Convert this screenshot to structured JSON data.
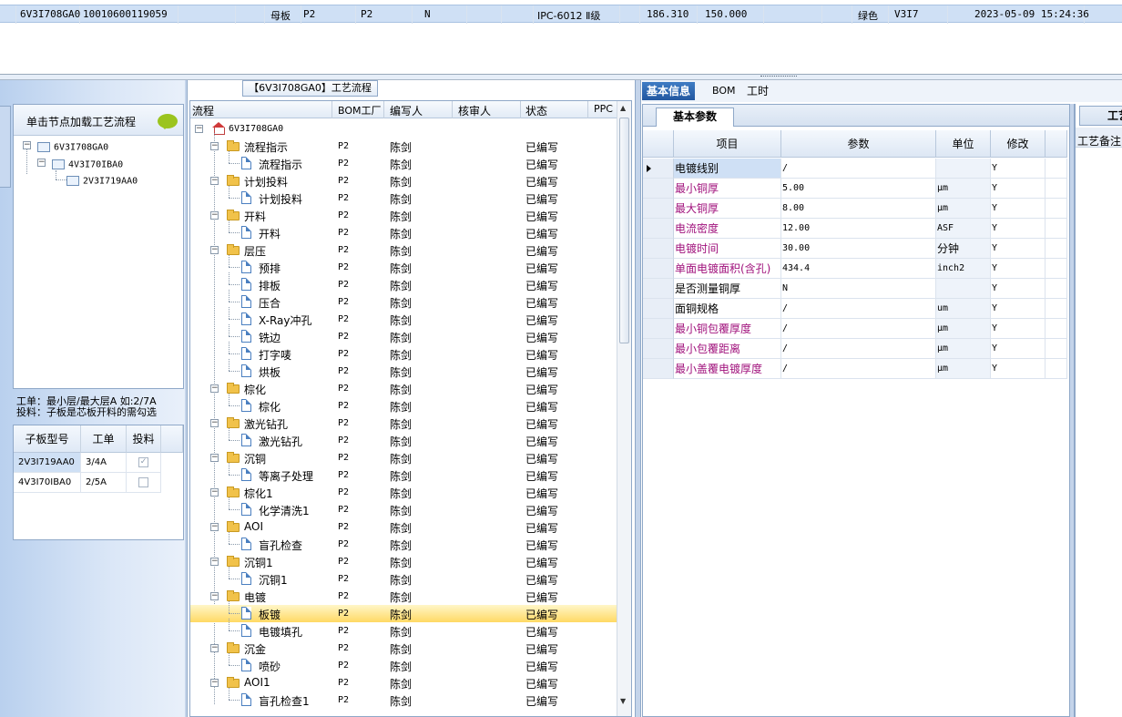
{
  "top_row": [
    "6V3I708GA0",
    "10010600119059",
    "母板",
    "P2",
    "P2",
    "N",
    "IPC-6012 Ⅱ级",
    "186.310",
    "150.000",
    "绿色",
    "V3I7",
    "2023-05-09 15:24:36"
  ],
  "left": {
    "header": "单击节点加载工艺流程",
    "tree": [
      "6V3I708GA0",
      "4V3I70IBA0",
      "2V3I719AA0"
    ],
    "note_line1": "工单：最小层/最大层A 如:2/7A",
    "note_line2": "投料：子板是芯板开料的需勾选",
    "grid_headers": [
      "子板型号",
      "工单",
      "投料"
    ],
    "grid_rows": [
      {
        "model": "2V3I719AA0",
        "order": "3/4A",
        "checked": true
      },
      {
        "model": "4V3I70IBA0",
        "order": "2/5A",
        "checked": false
      }
    ]
  },
  "middle": {
    "title": "【6V3I708GA0】工艺流程",
    "headers": [
      "流程",
      "BOM工厂",
      "编写人",
      "核审人",
      "状态",
      "PPC"
    ],
    "root": "6V3I708GA0",
    "rows": [
      {
        "name": "流程指示",
        "level": 1,
        "factory": "P2",
        "writer": "陈剑",
        "status": "已编写"
      },
      {
        "name": "流程指示",
        "level": 2,
        "factory": "P2",
        "writer": "陈剑",
        "status": "已编写"
      },
      {
        "name": "计划投料",
        "level": 1,
        "factory": "P2",
        "writer": "陈剑",
        "status": "已编写"
      },
      {
        "name": "计划投料",
        "level": 2,
        "factory": "P2",
        "writer": "陈剑",
        "status": "已编写"
      },
      {
        "name": "开料",
        "level": 1,
        "factory": "P2",
        "writer": "陈剑",
        "status": "已编写"
      },
      {
        "name": "开料",
        "level": 2,
        "factory": "P2",
        "writer": "陈剑",
        "status": "已编写"
      },
      {
        "name": "层压",
        "level": 1,
        "factory": "P2",
        "writer": "陈剑",
        "status": "已编写"
      },
      {
        "name": "预排",
        "level": 2,
        "factory": "P2",
        "writer": "陈剑",
        "status": "已编写"
      },
      {
        "name": "排板",
        "level": 2,
        "factory": "P2",
        "writer": "陈剑",
        "status": "已编写"
      },
      {
        "name": "压合",
        "level": 2,
        "factory": "P2",
        "writer": "陈剑",
        "status": "已编写"
      },
      {
        "name": "X-Ray冲孔",
        "level": 2,
        "factory": "P2",
        "writer": "陈剑",
        "status": "已编写"
      },
      {
        "name": "铣边",
        "level": 2,
        "factory": "P2",
        "writer": "陈剑",
        "status": "已编写"
      },
      {
        "name": "打字唛",
        "level": 2,
        "factory": "P2",
        "writer": "陈剑",
        "status": "已编写"
      },
      {
        "name": "烘板",
        "level": 2,
        "factory": "P2",
        "writer": "陈剑",
        "status": "已编写"
      },
      {
        "name": "棕化",
        "level": 1,
        "factory": "P2",
        "writer": "陈剑",
        "status": "已编写"
      },
      {
        "name": "棕化",
        "level": 2,
        "factory": "P2",
        "writer": "陈剑",
        "status": "已编写"
      },
      {
        "name": "激光钻孔",
        "level": 1,
        "factory": "P2",
        "writer": "陈剑",
        "status": "已编写"
      },
      {
        "name": "激光钻孔",
        "level": 2,
        "factory": "P2",
        "writer": "陈剑",
        "status": "已编写"
      },
      {
        "name": "沉铜",
        "level": 1,
        "factory": "P2",
        "writer": "陈剑",
        "status": "已编写"
      },
      {
        "name": "等离子处理",
        "level": 2,
        "factory": "P2",
        "writer": "陈剑",
        "status": "已编写"
      },
      {
        "name": "棕化1",
        "level": 1,
        "factory": "P2",
        "writer": "陈剑",
        "status": "已编写"
      },
      {
        "name": "化学清洗1",
        "level": 2,
        "factory": "P2",
        "writer": "陈剑",
        "status": "已编写"
      },
      {
        "name": "AOI",
        "level": 1,
        "factory": "P2",
        "writer": "陈剑",
        "status": "已编写"
      },
      {
        "name": "盲孔检查",
        "level": 2,
        "factory": "P2",
        "writer": "陈剑",
        "status": "已编写"
      },
      {
        "name": "沉铜1",
        "level": 1,
        "factory": "P2",
        "writer": "陈剑",
        "status": "已编写"
      },
      {
        "name": "沉铜1",
        "level": 2,
        "factory": "P2",
        "writer": "陈剑",
        "status": "已编写"
      },
      {
        "name": "电镀",
        "level": 1,
        "factory": "P2",
        "writer": "陈剑",
        "status": "已编写"
      },
      {
        "name": "板镀",
        "level": 2,
        "factory": "P2",
        "writer": "陈剑",
        "status": "已编写",
        "selected": true
      },
      {
        "name": "电镀填孔",
        "level": 2,
        "factory": "P2",
        "writer": "陈剑",
        "status": "已编写"
      },
      {
        "name": "沉金",
        "level": 1,
        "factory": "P2",
        "writer": "陈剑",
        "status": "已编写"
      },
      {
        "name": "喷砂",
        "level": 2,
        "factory": "P2",
        "writer": "陈剑",
        "status": "已编写"
      },
      {
        "name": "AOI1",
        "level": 1,
        "factory": "P2",
        "writer": "陈剑",
        "status": "已编写"
      },
      {
        "name": "盲孔检查1",
        "level": 2,
        "factory": "P2",
        "writer": "陈剑",
        "status": "已编写"
      }
    ]
  },
  "right": {
    "tabs": [
      "基本信息",
      "BOM",
      "工时"
    ],
    "subtab": "基本参数",
    "headers": [
      "项目",
      "参数",
      "单位",
      "修改"
    ],
    "rows": [
      {
        "item": "电镀线别",
        "param": "/",
        "unit": "",
        "mod": "Y",
        "color": "#000000",
        "selected": true
      },
      {
        "item": "最小铜厚",
        "param": "5.00",
        "unit": "μm",
        "mod": "Y",
        "color": "#a0127c"
      },
      {
        "item": "最大铜厚",
        "param": "8.00",
        "unit": "μm",
        "mod": "Y",
        "color": "#a0127c"
      },
      {
        "item": "电流密度",
        "param": "12.00",
        "unit": "ASF",
        "mod": "Y",
        "color": "#a0127c"
      },
      {
        "item": "电镀时间",
        "param": "30.00",
        "unit": "分钟",
        "mod": "Y",
        "color": "#a0127c"
      },
      {
        "item": "单面电镀面积(含孔)",
        "param": "434.4",
        "unit": "inch2",
        "mod": "Y",
        "color": "#a0127c"
      },
      {
        "item": "是否测量铜厚",
        "param": "N",
        "unit": "",
        "mod": "Y",
        "color": "#000000"
      },
      {
        "item": "面铜规格",
        "param": "/",
        "unit": "um",
        "mod": "Y",
        "color": "#000000"
      },
      {
        "item": "最小铜包覆厚度",
        "param": "/",
        "unit": "μm",
        "mod": "Y",
        "color": "#a0127c"
      },
      {
        "item": "最小包覆距离",
        "param": "/",
        "unit": "μm",
        "mod": "Y",
        "color": "#a0127c"
      },
      {
        "item": "最小盖覆电镀厚度",
        "param": "/",
        "unit": "μm",
        "mod": "Y",
        "color": "#a0127c"
      }
    ]
  },
  "far_right": {
    "tab": "工艺",
    "label": "工艺备注"
  }
}
